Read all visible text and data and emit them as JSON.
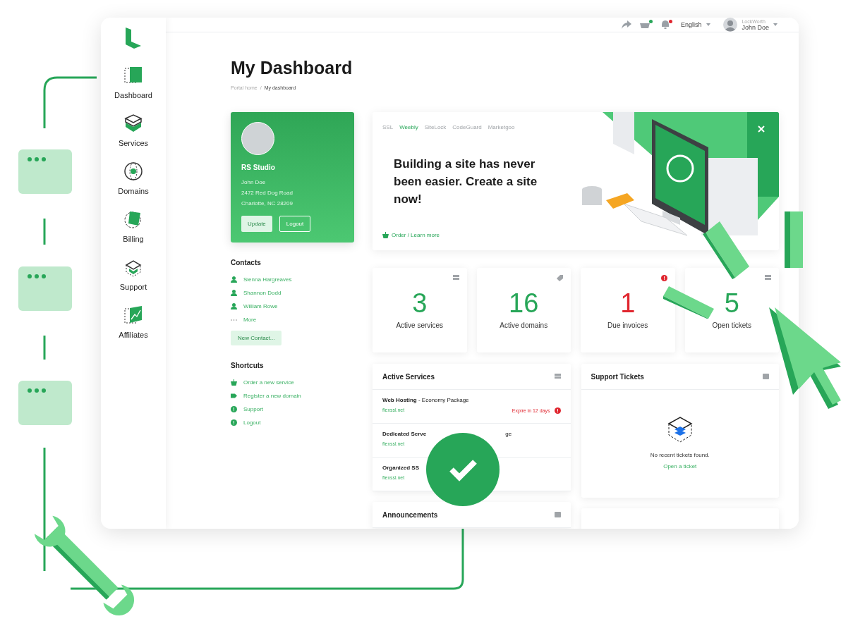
{
  "topbar": {
    "language": "English",
    "account": {
      "company": "LockWorth",
      "name": "John Doe"
    }
  },
  "sidebar": {
    "items": [
      {
        "label": "Dashboard",
        "kind": "dashboard"
      },
      {
        "label": "Services",
        "kind": "services"
      },
      {
        "label": "Domains",
        "kind": "domains"
      },
      {
        "label": "Billing",
        "kind": "billing"
      },
      {
        "label": "Support",
        "kind": "support"
      },
      {
        "label": "Affiliates",
        "kind": "affiliates"
      }
    ]
  },
  "page": {
    "title": "My Dashboard",
    "breadcrumb": {
      "items": [
        "Portal home",
        "My dashboard"
      ],
      "separator": "/"
    }
  },
  "profile": {
    "company": "RS Studio",
    "lines": [
      "John Doe",
      "2472 Red Dog Road",
      "Charlotte, NC 28209"
    ],
    "buttons": [
      {
        "label": "Update",
        "kind": "primary"
      },
      {
        "label": "Logout",
        "kind": "outline"
      }
    ]
  },
  "contacts": {
    "title": "Contacts",
    "items": [
      {
        "label": "Sienna Hargreaves",
        "kind": "person"
      },
      {
        "label": "Shannon Dodd",
        "kind": "person"
      },
      {
        "label": "William Rowe",
        "kind": "person"
      },
      {
        "label": "More",
        "kind": "more"
      }
    ],
    "button": "New Contact..."
  },
  "shortcuts": {
    "title": "Shortcuts",
    "items": [
      {
        "label": "Order a new service",
        "kind": "basket"
      },
      {
        "label": "Register a new domain",
        "kind": "tag"
      },
      {
        "label": "Support",
        "kind": "alert"
      },
      {
        "label": "Logout",
        "kind": "alert"
      }
    ]
  },
  "promo": {
    "tabs": [
      {
        "label": "SSL",
        "selected": false
      },
      {
        "label": "Weebly",
        "selected": true
      },
      {
        "label": "SiteLock",
        "selected": false
      },
      {
        "label": "CodeGuard",
        "selected": false
      },
      {
        "label": "Marketgoo",
        "selected": false
      }
    ],
    "heading": "Building a site has never been easier. Create a site now!",
    "link": "Order / Learn more"
  },
  "stats": [
    {
      "value": "3",
      "label": "Active services",
      "kind": "server",
      "color": "#27a658"
    },
    {
      "value": "16",
      "label": "Active domains",
      "kind": "tag",
      "color": "#27a658"
    },
    {
      "value": "1",
      "label": "Due invoices",
      "kind": "alert",
      "color": "#e0262f"
    },
    {
      "value": "5",
      "label": "Open tickets",
      "kind": "server",
      "color": "#27a658"
    }
  ],
  "active_services": {
    "title": "Active Services",
    "items": [
      {
        "title": "**Web Hosting** - Economy Package",
        "domain": "flexssl.net",
        "warning": "Expire in 12 days"
      },
      {
        "title": "**Dedicated Serve**",
        "tail": "ge",
        "domain": "flexssl.net"
      },
      {
        "title": "**Organized SS**",
        "domain": "flexssl.net"
      }
    ]
  },
  "support_tickets": {
    "title": "Support Tickets",
    "empty_text": "No recent tickets found.",
    "link": "Open a ticket"
  },
  "announcements": {
    "title": "Announcements"
  }
}
